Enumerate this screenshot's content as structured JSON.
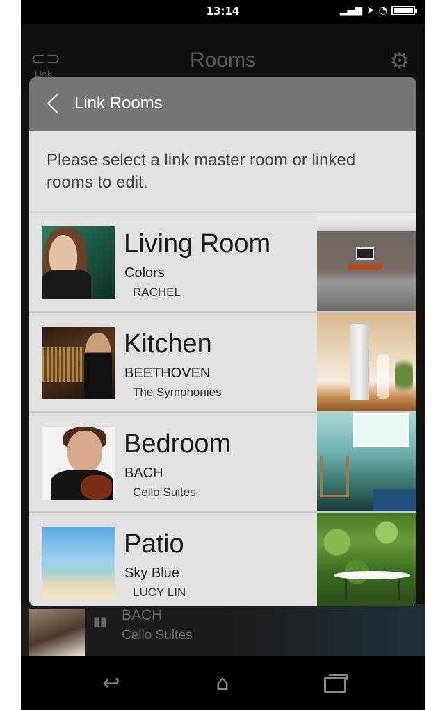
{
  "status_bar": {
    "time": "13:14",
    "signal_icon": "signal-icon",
    "location_icon": "location-arrow-icon",
    "wifi_icon": "wifi-icon",
    "battery_icon": "battery-icon"
  },
  "background": {
    "title": "Rooms",
    "link_label": "Link",
    "now_playing": {
      "artist": "BACH",
      "album": "Cello Suites"
    }
  },
  "dialog": {
    "title": "Link Rooms",
    "instruction": "Please select a link master room or linked rooms to edit."
  },
  "rooms": [
    {
      "name": "Living Room",
      "line1": "Colors",
      "line2": "RACHEL"
    },
    {
      "name": "Kitchen",
      "line1": "BEETHOVEN",
      "line2": "The Symphonies"
    },
    {
      "name": "Bedroom",
      "line1": "BACH",
      "line2": "Cello Suites"
    },
    {
      "name": "Patio",
      "line1": "Sky Blue",
      "line2": "LUCY LIN"
    }
  ],
  "nav": {
    "back_icon": "back-icon",
    "home_icon": "home-icon",
    "recent_icon": "recent-apps-icon"
  },
  "colors": {
    "dialog_header": "#767676",
    "dialog_bg": "#e1e1e1",
    "screen_bg": "#000000"
  }
}
